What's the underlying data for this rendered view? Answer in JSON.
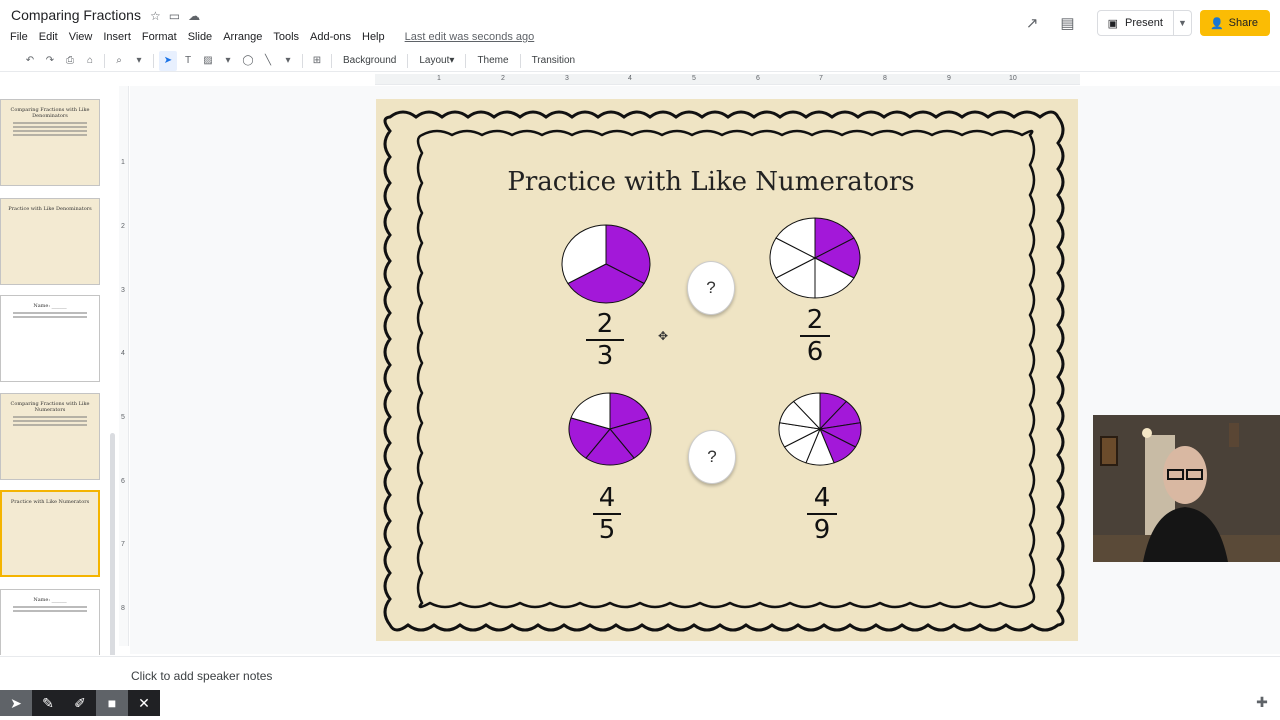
{
  "app": {
    "doc_title": "Comparing Fractions",
    "last_edit": "Last edit was seconds ago"
  },
  "menu": [
    "File",
    "Edit",
    "View",
    "Insert",
    "Format",
    "Slide",
    "Arrange",
    "Tools",
    "Add-ons",
    "Help"
  ],
  "header": {
    "present_label": "Present",
    "share_label": "Share"
  },
  "toolbar": {
    "background_label": "Background",
    "layout_label": "Layout",
    "theme_label": "Theme",
    "transition_label": "Transition"
  },
  "ruler": {
    "h_numbers": [
      "1",
      "2",
      "3",
      "4",
      "5",
      "6",
      "7",
      "8",
      "9",
      "10"
    ],
    "v_numbers": [
      "1",
      "2",
      "3",
      "4",
      "5",
      "6",
      "7",
      "8"
    ]
  },
  "filmstrip": {
    "slides": [
      {
        "title": "Comparing Fractions with Like Denominators"
      },
      {
        "title": "Practice with Like Denominators"
      },
      {
        "title": "Name: ______"
      },
      {
        "title": "Comparing Fractions with Like Numerators"
      },
      {
        "title": "Practice with Like Numerators",
        "active": true
      },
      {
        "title": "Name: ______"
      }
    ]
  },
  "slide": {
    "title": "Practice with Like Numerators",
    "fractions": [
      {
        "numerator": "2",
        "denominator": "3",
        "parts": 3,
        "filled": 2
      },
      {
        "numerator": "2",
        "denominator": "6",
        "parts": 6,
        "filled": 2
      },
      {
        "numerator": "4",
        "denominator": "5",
        "parts": 5,
        "filled": 4
      },
      {
        "numerator": "4",
        "denominator": "9",
        "parts": 9,
        "filled": 4
      }
    ],
    "compare_symbols": [
      "?",
      "?"
    ],
    "fill_color": "#a318d9",
    "background_color": "#efe4c4"
  },
  "notes": {
    "placeholder": "Click to add speaker notes"
  },
  "colors": {
    "share_button": "#fbbc04",
    "active_thumb_border": "#f4b400"
  }
}
